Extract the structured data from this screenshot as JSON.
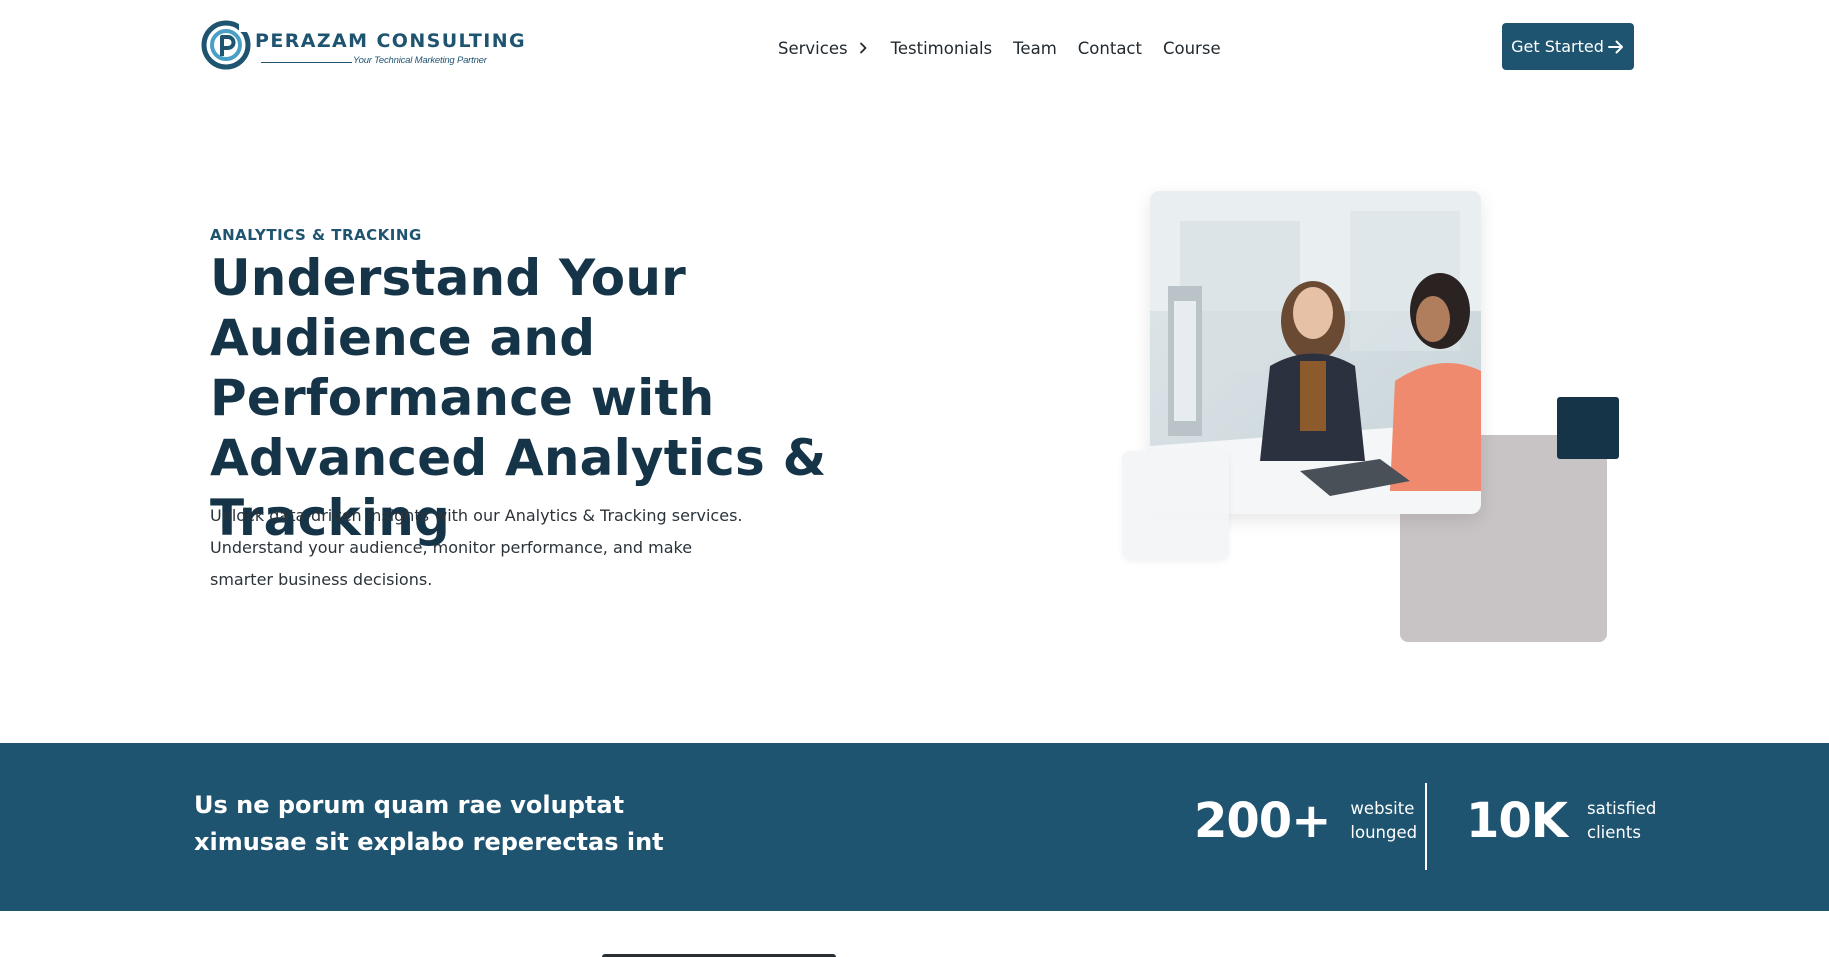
{
  "header": {
    "logo": {
      "name": "PERAZAM CONSULTING",
      "tagline": "Your Technical Marketing Partner"
    },
    "nav": [
      {
        "label": "Services",
        "has_submenu": true
      },
      {
        "label": "Testimonials"
      },
      {
        "label": "Team"
      },
      {
        "label": "Contact"
      },
      {
        "label": "Course"
      }
    ],
    "cta_label": "Get Started"
  },
  "hero": {
    "eyebrow": "ANALYTICS & TRACKING",
    "title": "Understand Your Audience and Performance with Advanced Analytics & Tracking",
    "description": "Unlock data-driven insights with our Analytics & Tracking services. Understand your audience, monitor performance, and make smarter business decisions."
  },
  "stats_band": {
    "text": "Us ne porum quam rae voluptat ximusae sit explabo reperectas int",
    "stats": [
      {
        "number": "200+",
        "label": "website lounged"
      },
      {
        "number": "10K",
        "label": "satisfied clients"
      }
    ]
  },
  "colors": {
    "brand": "#1f5470",
    "heading": "#163448",
    "accent_tile": "#163448",
    "gray_tile": "#c8c3c4"
  },
  "icons": [
    "logo-mark-icon",
    "chevron-right-icon",
    "arrow-right-icon"
  ]
}
